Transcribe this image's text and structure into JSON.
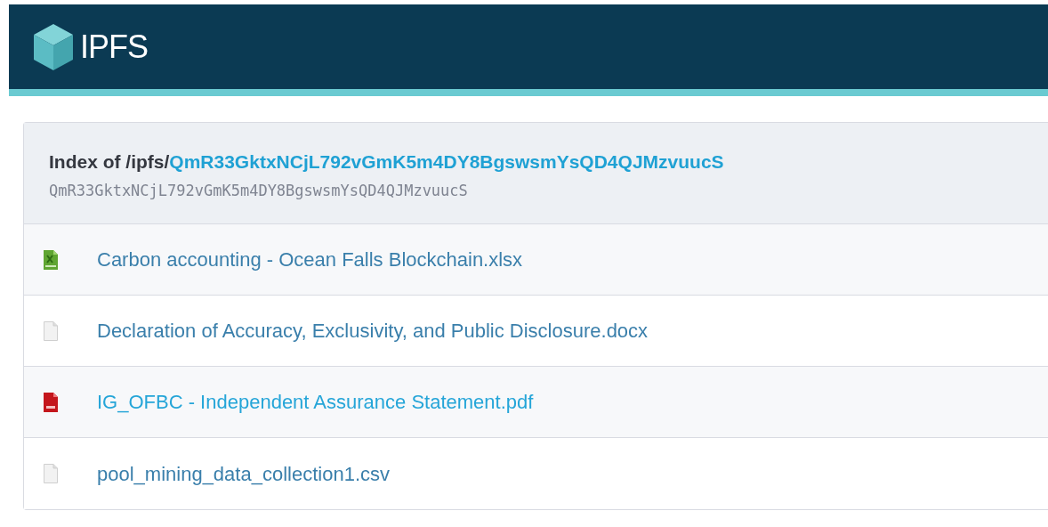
{
  "header": {
    "logo_text": "IPFS"
  },
  "index": {
    "prefix": "Index of /ipfs/",
    "hash_link": "QmR33GktxNCjL792vGmK5m4DY8BgswsmYsQD4QJMzvuucS",
    "hash": "QmR33GktxNCjL792vGmK5m4DY8BgswsmYsQD4QJMzvuucS"
  },
  "files": [
    {
      "kind": "spreadsheet",
      "name": "Carbon accounting - Ocean Falls Blockchain.xlsx",
      "hovered": false
    },
    {
      "kind": "document",
      "name": "Declaration of Accuracy, Exclusivity, and Public Disclosure.docx",
      "hovered": false
    },
    {
      "kind": "pdf",
      "name": "IG_OFBC - Independent Assurance Statement.pdf",
      "hovered": true
    },
    {
      "kind": "document",
      "name": "pool_mining_data_collection1.csv",
      "hovered": false
    }
  ]
}
